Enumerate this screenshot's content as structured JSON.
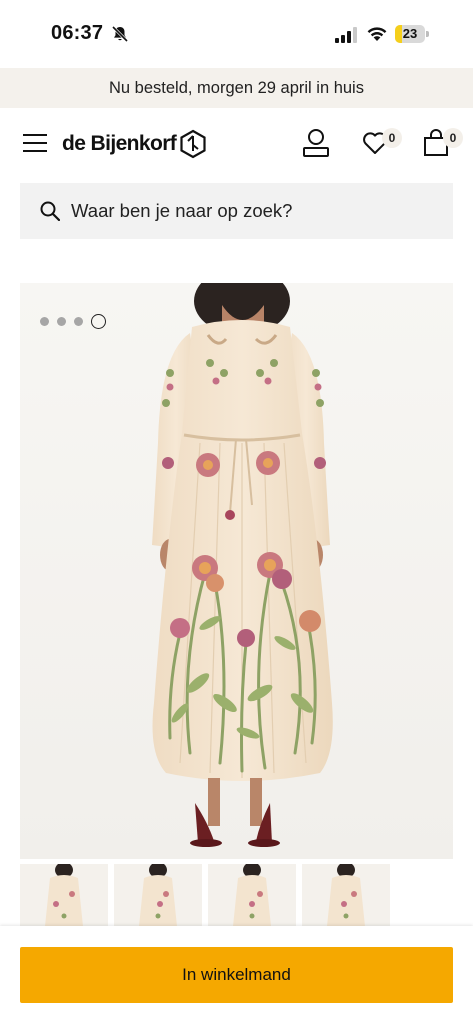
{
  "status_bar": {
    "time": "06:37",
    "battery_level": "23",
    "battery_fraction": 0.23
  },
  "promo": {
    "text": "Nu besteld, morgen 29 april in huis"
  },
  "header": {
    "logo_text": "de Bijenkorf",
    "wishlist_count": "0",
    "bag_count": "0"
  },
  "search": {
    "placeholder": "Waar ben je naar op zoek?"
  },
  "gallery": {
    "image_count": 4,
    "active_index": 3,
    "thumbnail_count": 4
  },
  "cta": {
    "label": "In winkelmand"
  },
  "colors": {
    "accent": "#f5a800",
    "banner_bg": "#f4f1ec",
    "search_bg": "#f2f2f2",
    "dress": "#f3e4cf"
  },
  "icons": [
    "bell-slash-icon",
    "signal-icon",
    "wifi-icon",
    "battery-icon",
    "menu-icon",
    "bijenkorf-logo-icon",
    "account-icon",
    "heart-icon",
    "bag-icon",
    "search-icon"
  ]
}
